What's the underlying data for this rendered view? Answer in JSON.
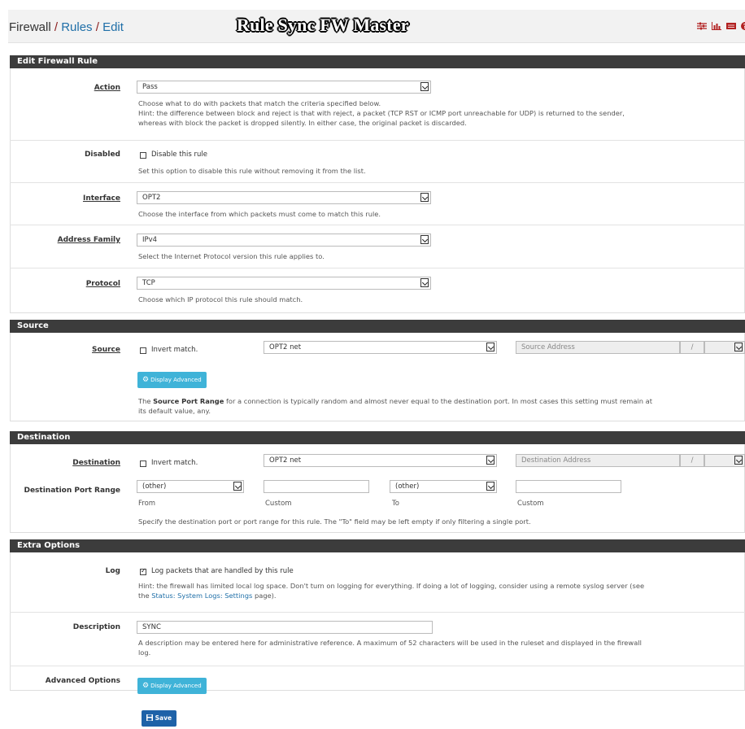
{
  "header": {
    "crumb_firewall": "Firewall",
    "crumb_rules": "Rules",
    "crumb_edit": "Edit",
    "sep1": "/",
    "sep2": "/",
    "overlay_title": "Rule Sync FW Master",
    "icons": [
      "sliders-icon",
      "chart-icon",
      "list-icon",
      "help-icon"
    ]
  },
  "sections": {
    "edit_rule": "Edit Firewall Rule",
    "source": "Source",
    "destination": "Destination",
    "extra": "Extra Options"
  },
  "action": {
    "label": "Action",
    "value": "Pass",
    "help1": "Choose what to do with packets that match the criteria specified below.",
    "help2": "Hint: the difference between block and reject is that with reject, a packet (TCP RST or ICMP port unreachable for UDP) is returned to the sender,",
    "help3": "whereas with block the packet is dropped silently. In either case, the original packet is discarded."
  },
  "disabled": {
    "label": "Disabled",
    "checkbox_label": "Disable this rule",
    "checked": false,
    "help": "Set this option to disable this rule without removing it from the list."
  },
  "interface": {
    "label": "Interface",
    "value": "OPT2",
    "help": "Choose the interface from which packets must come to match this rule."
  },
  "address_family": {
    "label": "Address Family",
    "value": "IPv4",
    "help": "Select the Internet Protocol version this rule applies to."
  },
  "protocol": {
    "label": "Protocol",
    "value": "TCP",
    "help": "Choose which IP protocol this rule should match."
  },
  "source": {
    "label": "Source",
    "invert_label": "Invert match.",
    "invert_checked": false,
    "type_value": "OPT2 net",
    "address_placeholder": "Source Address",
    "slash": "/",
    "advanced_button": "Display Advanced",
    "help_bold": "Source Port Range",
    "help_pre": "The ",
    "help_post": " for a connection is typically random and almost never equal to the destination port. In most cases this setting must remain at",
    "help_line2": "its default value, any."
  },
  "destination": {
    "label": "Destination",
    "invert_label": "Invert match.",
    "invert_checked": false,
    "type_value": "OPT2 net",
    "address_placeholder": "Destination Address",
    "slash": "/",
    "port_range_label": "Destination Port Range",
    "from_value": "(other)",
    "to_value": "(other)",
    "from_label": "From",
    "custom1_label": "Custom",
    "to_label": "To",
    "custom2_label": "Custom",
    "help": "Specify the destination port or port range for this rule. The \"To\" field may be left empty if only filtering a single port."
  },
  "log": {
    "label": "Log",
    "checkbox_label": "Log packets that are handled by this rule",
    "checked": true,
    "help1": "Hint: the firewall has limited local log space. Don't turn on logging for everything. If doing a lot of logging, consider using a remote syslog server (see",
    "help2_pre": "the ",
    "help2_link": "Status: System Logs: Settings",
    "help2_post": " page)."
  },
  "description": {
    "label": "Description",
    "value": "SYNC",
    "help1": "A description may be entered here for administrative reference. A maximum of 52 characters will be used in the ruleset and displayed in the firewall",
    "help2": "log."
  },
  "advanced_options": {
    "label": "Advanced Options",
    "button": "Display Advanced"
  },
  "save_button": "Save",
  "colors": {
    "section_bg": "#3c3c3c",
    "link": "#1f6fa8",
    "advanced_btn": "#3fb3d8",
    "save_btn": "#1e62a8",
    "header_icons": "#b22222"
  }
}
